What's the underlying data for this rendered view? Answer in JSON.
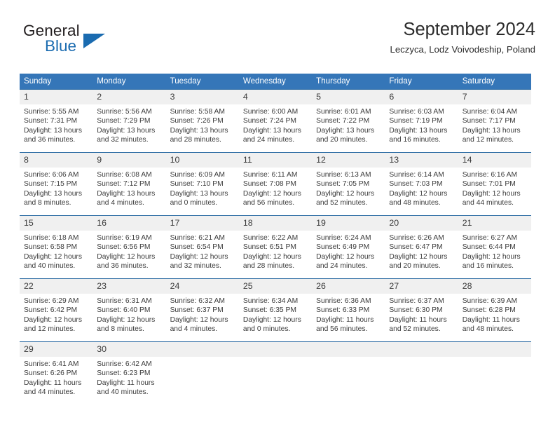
{
  "brand": {
    "name_top": "General",
    "name_bottom": "Blue",
    "accent_color": "#1a6bb0",
    "triangle_icon": "brand-triangle-icon"
  },
  "header": {
    "title": "September 2024",
    "subtitle": "Leczyca, Lodz Voivodeship, Poland"
  },
  "theme": {
    "header_blue": "#3576b8",
    "row_divider_blue": "#2e6da4",
    "daynum_gray": "#f0f0f0",
    "text_color": "#3b3b3b"
  },
  "calendar": {
    "weekday_headers": [
      "Sunday",
      "Monday",
      "Tuesday",
      "Wednesday",
      "Thursday",
      "Friday",
      "Saturday"
    ],
    "weeks": [
      [
        {
          "day": "1",
          "sunrise": "Sunrise: 5:55 AM",
          "sunset": "Sunset: 7:31 PM",
          "daylight_line1": "Daylight: 13 hours",
          "daylight_line2": "and 36 minutes."
        },
        {
          "day": "2",
          "sunrise": "Sunrise: 5:56 AM",
          "sunset": "Sunset: 7:29 PM",
          "daylight_line1": "Daylight: 13 hours",
          "daylight_line2": "and 32 minutes."
        },
        {
          "day": "3",
          "sunrise": "Sunrise: 5:58 AM",
          "sunset": "Sunset: 7:26 PM",
          "daylight_line1": "Daylight: 13 hours",
          "daylight_line2": "and 28 minutes."
        },
        {
          "day": "4",
          "sunrise": "Sunrise: 6:00 AM",
          "sunset": "Sunset: 7:24 PM",
          "daylight_line1": "Daylight: 13 hours",
          "daylight_line2": "and 24 minutes."
        },
        {
          "day": "5",
          "sunrise": "Sunrise: 6:01 AM",
          "sunset": "Sunset: 7:22 PM",
          "daylight_line1": "Daylight: 13 hours",
          "daylight_line2": "and 20 minutes."
        },
        {
          "day": "6",
          "sunrise": "Sunrise: 6:03 AM",
          "sunset": "Sunset: 7:19 PM",
          "daylight_line1": "Daylight: 13 hours",
          "daylight_line2": "and 16 minutes."
        },
        {
          "day": "7",
          "sunrise": "Sunrise: 6:04 AM",
          "sunset": "Sunset: 7:17 PM",
          "daylight_line1": "Daylight: 13 hours",
          "daylight_line2": "and 12 minutes."
        }
      ],
      [
        {
          "day": "8",
          "sunrise": "Sunrise: 6:06 AM",
          "sunset": "Sunset: 7:15 PM",
          "daylight_line1": "Daylight: 13 hours",
          "daylight_line2": "and 8 minutes."
        },
        {
          "day": "9",
          "sunrise": "Sunrise: 6:08 AM",
          "sunset": "Sunset: 7:12 PM",
          "daylight_line1": "Daylight: 13 hours",
          "daylight_line2": "and 4 minutes."
        },
        {
          "day": "10",
          "sunrise": "Sunrise: 6:09 AM",
          "sunset": "Sunset: 7:10 PM",
          "daylight_line1": "Daylight: 13 hours",
          "daylight_line2": "and 0 minutes."
        },
        {
          "day": "11",
          "sunrise": "Sunrise: 6:11 AM",
          "sunset": "Sunset: 7:08 PM",
          "daylight_line1": "Daylight: 12 hours",
          "daylight_line2": "and 56 minutes."
        },
        {
          "day": "12",
          "sunrise": "Sunrise: 6:13 AM",
          "sunset": "Sunset: 7:05 PM",
          "daylight_line1": "Daylight: 12 hours",
          "daylight_line2": "and 52 minutes."
        },
        {
          "day": "13",
          "sunrise": "Sunrise: 6:14 AM",
          "sunset": "Sunset: 7:03 PM",
          "daylight_line1": "Daylight: 12 hours",
          "daylight_line2": "and 48 minutes."
        },
        {
          "day": "14",
          "sunrise": "Sunrise: 6:16 AM",
          "sunset": "Sunset: 7:01 PM",
          "daylight_line1": "Daylight: 12 hours",
          "daylight_line2": "and 44 minutes."
        }
      ],
      [
        {
          "day": "15",
          "sunrise": "Sunrise: 6:18 AM",
          "sunset": "Sunset: 6:58 PM",
          "daylight_line1": "Daylight: 12 hours",
          "daylight_line2": "and 40 minutes."
        },
        {
          "day": "16",
          "sunrise": "Sunrise: 6:19 AM",
          "sunset": "Sunset: 6:56 PM",
          "daylight_line1": "Daylight: 12 hours",
          "daylight_line2": "and 36 minutes."
        },
        {
          "day": "17",
          "sunrise": "Sunrise: 6:21 AM",
          "sunset": "Sunset: 6:54 PM",
          "daylight_line1": "Daylight: 12 hours",
          "daylight_line2": "and 32 minutes."
        },
        {
          "day": "18",
          "sunrise": "Sunrise: 6:22 AM",
          "sunset": "Sunset: 6:51 PM",
          "daylight_line1": "Daylight: 12 hours",
          "daylight_line2": "and 28 minutes."
        },
        {
          "day": "19",
          "sunrise": "Sunrise: 6:24 AM",
          "sunset": "Sunset: 6:49 PM",
          "daylight_line1": "Daylight: 12 hours",
          "daylight_line2": "and 24 minutes."
        },
        {
          "day": "20",
          "sunrise": "Sunrise: 6:26 AM",
          "sunset": "Sunset: 6:47 PM",
          "daylight_line1": "Daylight: 12 hours",
          "daylight_line2": "and 20 minutes."
        },
        {
          "day": "21",
          "sunrise": "Sunrise: 6:27 AM",
          "sunset": "Sunset: 6:44 PM",
          "daylight_line1": "Daylight: 12 hours",
          "daylight_line2": "and 16 minutes."
        }
      ],
      [
        {
          "day": "22",
          "sunrise": "Sunrise: 6:29 AM",
          "sunset": "Sunset: 6:42 PM",
          "daylight_line1": "Daylight: 12 hours",
          "daylight_line2": "and 12 minutes."
        },
        {
          "day": "23",
          "sunrise": "Sunrise: 6:31 AM",
          "sunset": "Sunset: 6:40 PM",
          "daylight_line1": "Daylight: 12 hours",
          "daylight_line2": "and 8 minutes."
        },
        {
          "day": "24",
          "sunrise": "Sunrise: 6:32 AM",
          "sunset": "Sunset: 6:37 PM",
          "daylight_line1": "Daylight: 12 hours",
          "daylight_line2": "and 4 minutes."
        },
        {
          "day": "25",
          "sunrise": "Sunrise: 6:34 AM",
          "sunset": "Sunset: 6:35 PM",
          "daylight_line1": "Daylight: 12 hours",
          "daylight_line2": "and 0 minutes."
        },
        {
          "day": "26",
          "sunrise": "Sunrise: 6:36 AM",
          "sunset": "Sunset: 6:33 PM",
          "daylight_line1": "Daylight: 11 hours",
          "daylight_line2": "and 56 minutes."
        },
        {
          "day": "27",
          "sunrise": "Sunrise: 6:37 AM",
          "sunset": "Sunset: 6:30 PM",
          "daylight_line1": "Daylight: 11 hours",
          "daylight_line2": "and 52 minutes."
        },
        {
          "day": "28",
          "sunrise": "Sunrise: 6:39 AM",
          "sunset": "Sunset: 6:28 PM",
          "daylight_line1": "Daylight: 11 hours",
          "daylight_line2": "and 48 minutes."
        }
      ],
      [
        {
          "day": "29",
          "sunrise": "Sunrise: 6:41 AM",
          "sunset": "Sunset: 6:26 PM",
          "daylight_line1": "Daylight: 11 hours",
          "daylight_line2": "and 44 minutes."
        },
        {
          "day": "30",
          "sunrise": "Sunrise: 6:42 AM",
          "sunset": "Sunset: 6:23 PM",
          "daylight_line1": "Daylight: 11 hours",
          "daylight_line2": "and 40 minutes."
        },
        {
          "day": "",
          "sunrise": "",
          "sunset": "",
          "daylight_line1": "",
          "daylight_line2": ""
        },
        {
          "day": "",
          "sunrise": "",
          "sunset": "",
          "daylight_line1": "",
          "daylight_line2": ""
        },
        {
          "day": "",
          "sunrise": "",
          "sunset": "",
          "daylight_line1": "",
          "daylight_line2": ""
        },
        {
          "day": "",
          "sunrise": "",
          "sunset": "",
          "daylight_line1": "",
          "daylight_line2": ""
        },
        {
          "day": "",
          "sunrise": "",
          "sunset": "",
          "daylight_line1": "",
          "daylight_line2": ""
        }
      ]
    ]
  }
}
